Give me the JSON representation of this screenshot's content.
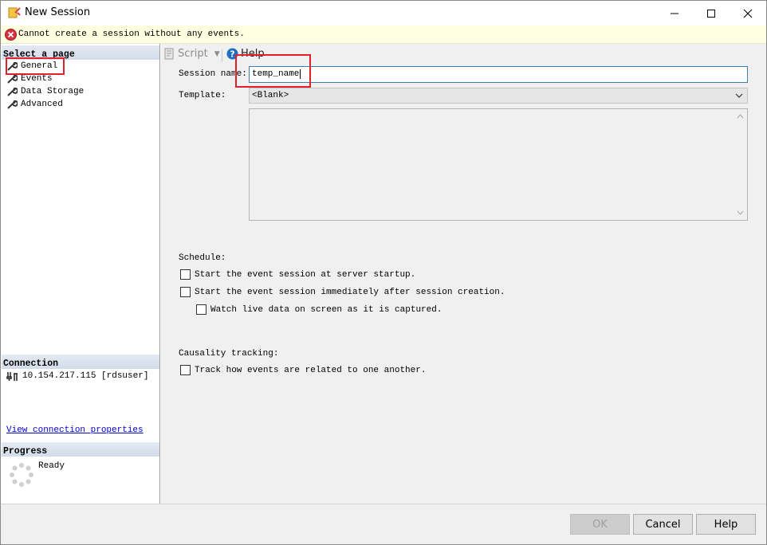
{
  "window": {
    "title": "New Session"
  },
  "error": {
    "message": "Cannot create a session without any events."
  },
  "left": {
    "select_page_header": "Select a page",
    "pages": [
      {
        "label": "General",
        "selected": true
      },
      {
        "label": "Events"
      },
      {
        "label": "Data Storage"
      },
      {
        "label": "Advanced"
      }
    ],
    "connection_header": "Connection",
    "connection_text": "10.154.217.115 [rdsuser]",
    "view_connection_link": "View connection properties",
    "progress_header": "Progress",
    "progress_status": "Ready"
  },
  "toolbar": {
    "script_label": "Script",
    "help_label": "Help"
  },
  "form": {
    "session_name_label": "Session name:",
    "session_name_value": "temp_name",
    "template_label": "Template:",
    "template_value": "<Blank>",
    "schedule_label": "Schedule:",
    "start_at_startup": "Start the event session at server startup.",
    "start_immediately": "Start the event session immediately after session creation.",
    "watch_live": "Watch live data on screen as it is captured.",
    "causality_label": "Causality tracking:",
    "track_events": "Track how events are related to one another."
  },
  "buttons": {
    "ok": "OK",
    "cancel": "Cancel",
    "help": "Help"
  },
  "colors": {
    "error_bg": "#ffffe1",
    "annotation": "#e0202a",
    "link": "#0000cc",
    "header_bg": "#d9e1ee"
  }
}
